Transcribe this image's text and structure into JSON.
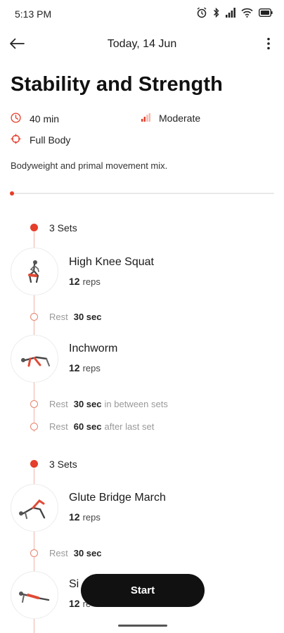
{
  "status_bar": {
    "time": "5:13 PM"
  },
  "app_bar": {
    "title": "Today, 14 Jun"
  },
  "workout": {
    "title": "Stability and Strength",
    "duration": "40 min",
    "intensity": "Moderate",
    "focus": "Full Body",
    "description": "Bodyweight and primal movement mix.",
    "progress_fraction": 0.01
  },
  "blocks": [
    {
      "sets_label": "3 Sets",
      "exercises": [
        {
          "name": "High Knee Squat",
          "reps": "12",
          "unit": "reps"
        },
        {
          "name": "Inchworm",
          "reps": "12",
          "unit": "reps"
        }
      ],
      "rests": [
        {
          "word": "Rest",
          "value": "30 sec",
          "note": ""
        },
        {
          "word": "Rest",
          "value": "30 sec",
          "note": "in between sets"
        },
        {
          "word": "Rest",
          "value": "60 sec",
          "note": "after last set"
        }
      ]
    },
    {
      "sets_label": "3 Sets",
      "exercises": [
        {
          "name": "Glute Bridge March",
          "reps": "12",
          "unit": "reps"
        },
        {
          "name": "Si",
          "reps": "12",
          "unit": "re"
        }
      ],
      "rests": [
        {
          "word": "Rest",
          "value": "30 sec",
          "note": ""
        }
      ]
    }
  ],
  "start_label": "Start",
  "colors": {
    "accent": "#e53e2a",
    "button": "#111111"
  }
}
